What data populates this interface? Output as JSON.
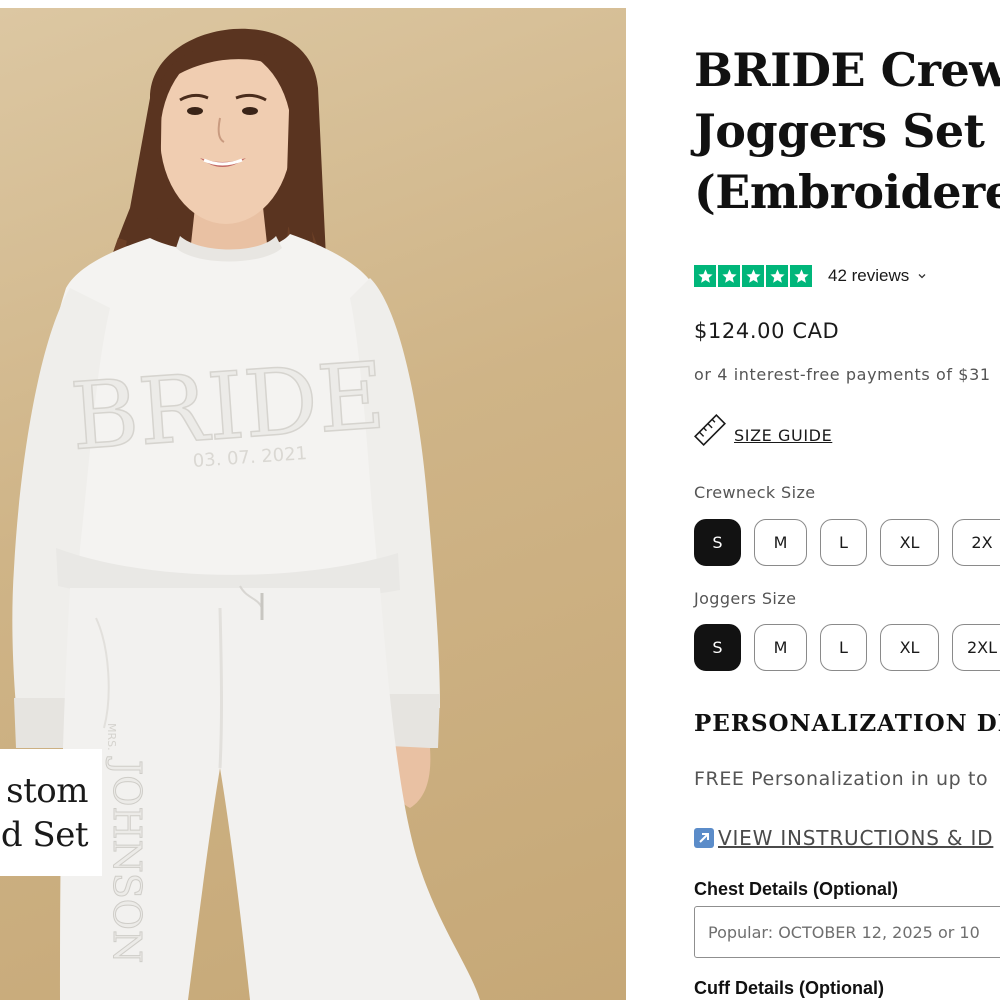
{
  "product": {
    "title_lines": [
      "BRIDE Crew",
      "Joggers Set",
      "(Embroidere"
    ],
    "rating": {
      "stars": 5,
      "reviews_label": "42 reviews"
    },
    "price": "$124.00 CAD",
    "installments": "or 4 interest-free payments of $31",
    "size_guide_label": "SIZE GUIDE"
  },
  "image": {
    "badge_lines": [
      "stom",
      "ed Set"
    ],
    "sweatshirt_text": "BRIDE",
    "sweatshirt_date": "03. 07. 2021",
    "jogger_small_text": "MRS.",
    "jogger_text": "JOHNSON"
  },
  "options": {
    "crewneck": {
      "label": "Crewneck Size",
      "sizes": [
        "S",
        "M",
        "L",
        "XL",
        "2X"
      ],
      "selected": "S"
    },
    "joggers": {
      "label": "Joggers Size",
      "sizes": [
        "S",
        "M",
        "L",
        "XL",
        "2XL"
      ],
      "selected": "S"
    }
  },
  "personalization": {
    "heading": "PERSONALIZATION DE",
    "free_text": "FREE Personalization in up to",
    "instructions_label": "VIEW INSTRUCTIONS & ID",
    "chest": {
      "label": "Chest Details (Optional)",
      "placeholder": "Popular: OCTOBER 12, 2025 or 10"
    },
    "cuff": {
      "label": "Cuff Details (Optional)"
    }
  },
  "colors": {
    "star_green": "#00b67a",
    "selected_bg": "#121212",
    "instructions_icon": "#5b8cc9"
  },
  "icons": [
    "star-icon",
    "chevron-down-icon",
    "ruler-icon",
    "external-arrow-icon"
  ]
}
